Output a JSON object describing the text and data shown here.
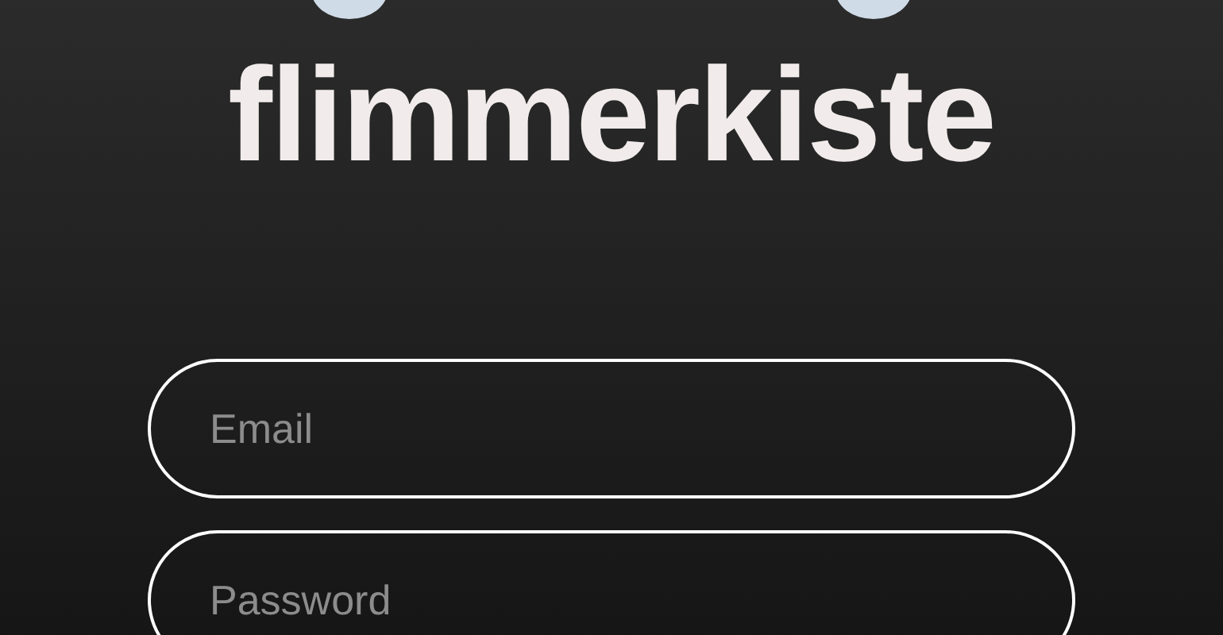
{
  "app_title": "flimmerkiste",
  "fields": [
    {
      "placeholder": "Email"
    },
    {
      "placeholder": "Password"
    }
  ]
}
